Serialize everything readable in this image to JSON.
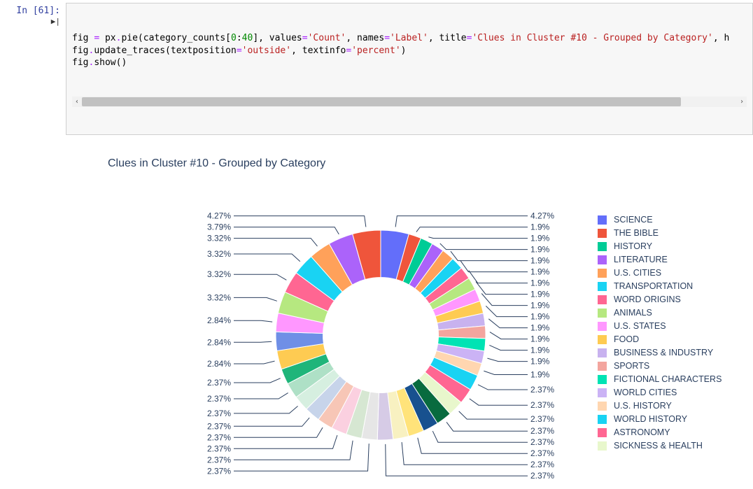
{
  "cell": {
    "prompt": "In [61]:",
    "code_tokens": [
      [
        {
          "t": "fig ",
          "c": "tok-name"
        },
        {
          "t": "=",
          "c": "tok-op"
        },
        {
          "t": " px",
          "c": "tok-name"
        },
        {
          "t": ".",
          "c": "tok-op"
        },
        {
          "t": "pie(category_counts[",
          "c": "tok-name"
        },
        {
          "t": "0",
          "c": "tok-num"
        },
        {
          "t": ":",
          "c": "tok-name"
        },
        {
          "t": "40",
          "c": "tok-num"
        },
        {
          "t": "], values",
          "c": "tok-name"
        },
        {
          "t": "=",
          "c": "tok-op"
        },
        {
          "t": "'Count'",
          "c": "tok-str"
        },
        {
          "t": ", names",
          "c": "tok-name"
        },
        {
          "t": "=",
          "c": "tok-op"
        },
        {
          "t": "'Label'",
          "c": "tok-str"
        },
        {
          "t": ", title",
          "c": "tok-name"
        },
        {
          "t": "=",
          "c": "tok-op"
        },
        {
          "t": "'Clues in Cluster #10 - Grouped by Category'",
          "c": "tok-str"
        },
        {
          "t": ", h",
          "c": "tok-name"
        }
      ],
      [
        {
          "t": "fig",
          "c": "tok-name"
        },
        {
          "t": ".",
          "c": "tok-op"
        },
        {
          "t": "update_traces(textposition",
          "c": "tok-name"
        },
        {
          "t": "=",
          "c": "tok-op"
        },
        {
          "t": "'outside'",
          "c": "tok-str"
        },
        {
          "t": ", textinfo",
          "c": "tok-name"
        },
        {
          "t": "=",
          "c": "tok-op"
        },
        {
          "t": "'percent'",
          "c": "tok-str"
        },
        {
          "t": ")",
          "c": "tok-name"
        }
      ],
      [
        {
          "t": "fig",
          "c": "tok-name"
        },
        {
          "t": ".",
          "c": "tok-op"
        },
        {
          "t": "show()",
          "c": "tok-name"
        }
      ]
    ]
  },
  "scroll": {
    "left_glyph": "‹",
    "right_glyph": "›"
  },
  "chart_data": {
    "type": "pie",
    "title": "Clues in Cluster #10 - Grouped by Category",
    "hole": 0.55,
    "slices": [
      {
        "label": "SCIENCE",
        "percent": 4.27,
        "color": "#636efa"
      },
      {
        "label": "THE BIBLE",
        "percent": 1.9,
        "color": "#ef553b"
      },
      {
        "label": "HISTORY",
        "percent": 1.9,
        "color": "#00cc96"
      },
      {
        "label": "LITERATURE",
        "percent": 1.9,
        "color": "#ab63fa"
      },
      {
        "label": "U.S. CITIES",
        "percent": 1.9,
        "color": "#ffa15a"
      },
      {
        "label": "TRANSPORTATION",
        "percent": 1.9,
        "color": "#19d3f3"
      },
      {
        "label": "WORD ORIGINS",
        "percent": 1.9,
        "color": "#ff6692"
      },
      {
        "label": "ANIMALS",
        "percent": 1.9,
        "color": "#b6e880"
      },
      {
        "label": "U.S. STATES",
        "percent": 1.9,
        "color": "#ff97ff"
      },
      {
        "label": "FOOD",
        "percent": 1.9,
        "color": "#fecb52"
      },
      {
        "label": "BUSINESS & INDUSTRY",
        "percent": 1.9,
        "color": "#c8b2ef"
      },
      {
        "label": "SPORTS",
        "percent": 1.9,
        "color": "#f3a59e"
      },
      {
        "label": "FICTIONAL CHARACTERS",
        "percent": 1.9,
        "color": "#00e3b4"
      },
      {
        "label": "WORLD CITIES",
        "percent": 1.9,
        "color": "#cbb3f5"
      },
      {
        "label": "U.S. HISTORY",
        "percent": 1.9,
        "color": "#ffd6b0"
      },
      {
        "label": "WORLD HISTORY",
        "percent": 2.37,
        "color": "#19d3f3"
      },
      {
        "label": "ASTRONOMY",
        "percent": 2.37,
        "color": "#ff6692"
      },
      {
        "label": "SICKNESS & HEALTH",
        "percent": 2.37,
        "color": "#e8f7cc"
      },
      {
        "label": "",
        "percent": 2.37,
        "color": "#086b3f"
      },
      {
        "label": "",
        "percent": 2.37,
        "color": "#18518f"
      },
      {
        "label": "",
        "percent": 2.37,
        "color": "#ffe37a"
      },
      {
        "label": "",
        "percent": 2.37,
        "color": "#f8f1c1"
      },
      {
        "label": "",
        "percent": 2.37,
        "color": "#d6cbe6"
      },
      {
        "label": "",
        "percent": 2.37,
        "color": "#e6e6e6"
      },
      {
        "label": "",
        "percent": 2.37,
        "color": "#d6e7d2"
      },
      {
        "label": "",
        "percent": 2.37,
        "color": "#fbd0e0"
      },
      {
        "label": "",
        "percent": 2.37,
        "color": "#f7c6b6"
      },
      {
        "label": "",
        "percent": 2.37,
        "color": "#c7d4ea"
      },
      {
        "label": "",
        "percent": 2.37,
        "color": "#d6efe0"
      },
      {
        "label": "",
        "percent": 2.37,
        "color": "#aee0c6"
      },
      {
        "label": "",
        "percent": 2.37,
        "color": "#1fb57a"
      },
      {
        "label": "",
        "percent": 2.84,
        "color": "#fecb52"
      },
      {
        "label": "",
        "percent": 2.84,
        "color": "#6f8fe6"
      },
      {
        "label": "",
        "percent": 2.84,
        "color": "#ff97ff"
      },
      {
        "label": "",
        "percent": 3.32,
        "color": "#b6e880"
      },
      {
        "label": "",
        "percent": 3.32,
        "color": "#ff6692"
      },
      {
        "label": "",
        "percent": 3.32,
        "color": "#19d3f3"
      },
      {
        "label": "",
        "percent": 3.32,
        "color": "#ffa15a"
      },
      {
        "label": "",
        "percent": 3.79,
        "color": "#ab63fa"
      },
      {
        "label": "",
        "percent": 4.27,
        "color": "#ef553b"
      }
    ],
    "legend": [
      {
        "label": "SCIENCE",
        "color": "#636efa"
      },
      {
        "label": "THE BIBLE",
        "color": "#ef553b"
      },
      {
        "label": "HISTORY",
        "color": "#00cc96"
      },
      {
        "label": "LITERATURE",
        "color": "#ab63fa"
      },
      {
        "label": "U.S. CITIES",
        "color": "#ffa15a"
      },
      {
        "label": "TRANSPORTATION",
        "color": "#19d3f3"
      },
      {
        "label": "WORD ORIGINS",
        "color": "#ff6692"
      },
      {
        "label": "ANIMALS",
        "color": "#b6e880"
      },
      {
        "label": "U.S. STATES",
        "color": "#ff97ff"
      },
      {
        "label": "FOOD",
        "color": "#fecb52"
      },
      {
        "label": "BUSINESS & INDUSTRY",
        "color": "#c8b2ef"
      },
      {
        "label": "SPORTS",
        "color": "#f3a59e"
      },
      {
        "label": "FICTIONAL CHARACTERS",
        "color": "#00e3b4"
      },
      {
        "label": "WORLD CITIES",
        "color": "#cbb3f5"
      },
      {
        "label": "U.S. HISTORY",
        "color": "#ffd6b0"
      },
      {
        "label": "WORLD HISTORY",
        "color": "#19d3f3"
      },
      {
        "label": "ASTRONOMY",
        "color": "#ff6692"
      },
      {
        "label": "SICKNESS & HEALTH",
        "color": "#e8f7cc"
      }
    ],
    "outer_labels": [
      "4.27%",
      "1.9%",
      "1.9%",
      "1.9%",
      "1.9%",
      "1.9%",
      "1.9%",
      "1.9%",
      "1.9%",
      "1.9%",
      "1.9%",
      "1.9%",
      "1.9%",
      "1.9%",
      "1.9%",
      "2.37%",
      "2.37%",
      "2.37%",
      "2.37%",
      "2.37%",
      "2.37%",
      "2.37%",
      "2.37%",
      "2.37%",
      "2.37%",
      "2.37%",
      "2.37%",
      "2.37%",
      "2.37%",
      "2.37%",
      "2.37%",
      "2.84%",
      "2.84%",
      "2.84%",
      "3.32%",
      "3.32%",
      "3.32%",
      "3.32%",
      "3.79%",
      "4.27%"
    ]
  }
}
